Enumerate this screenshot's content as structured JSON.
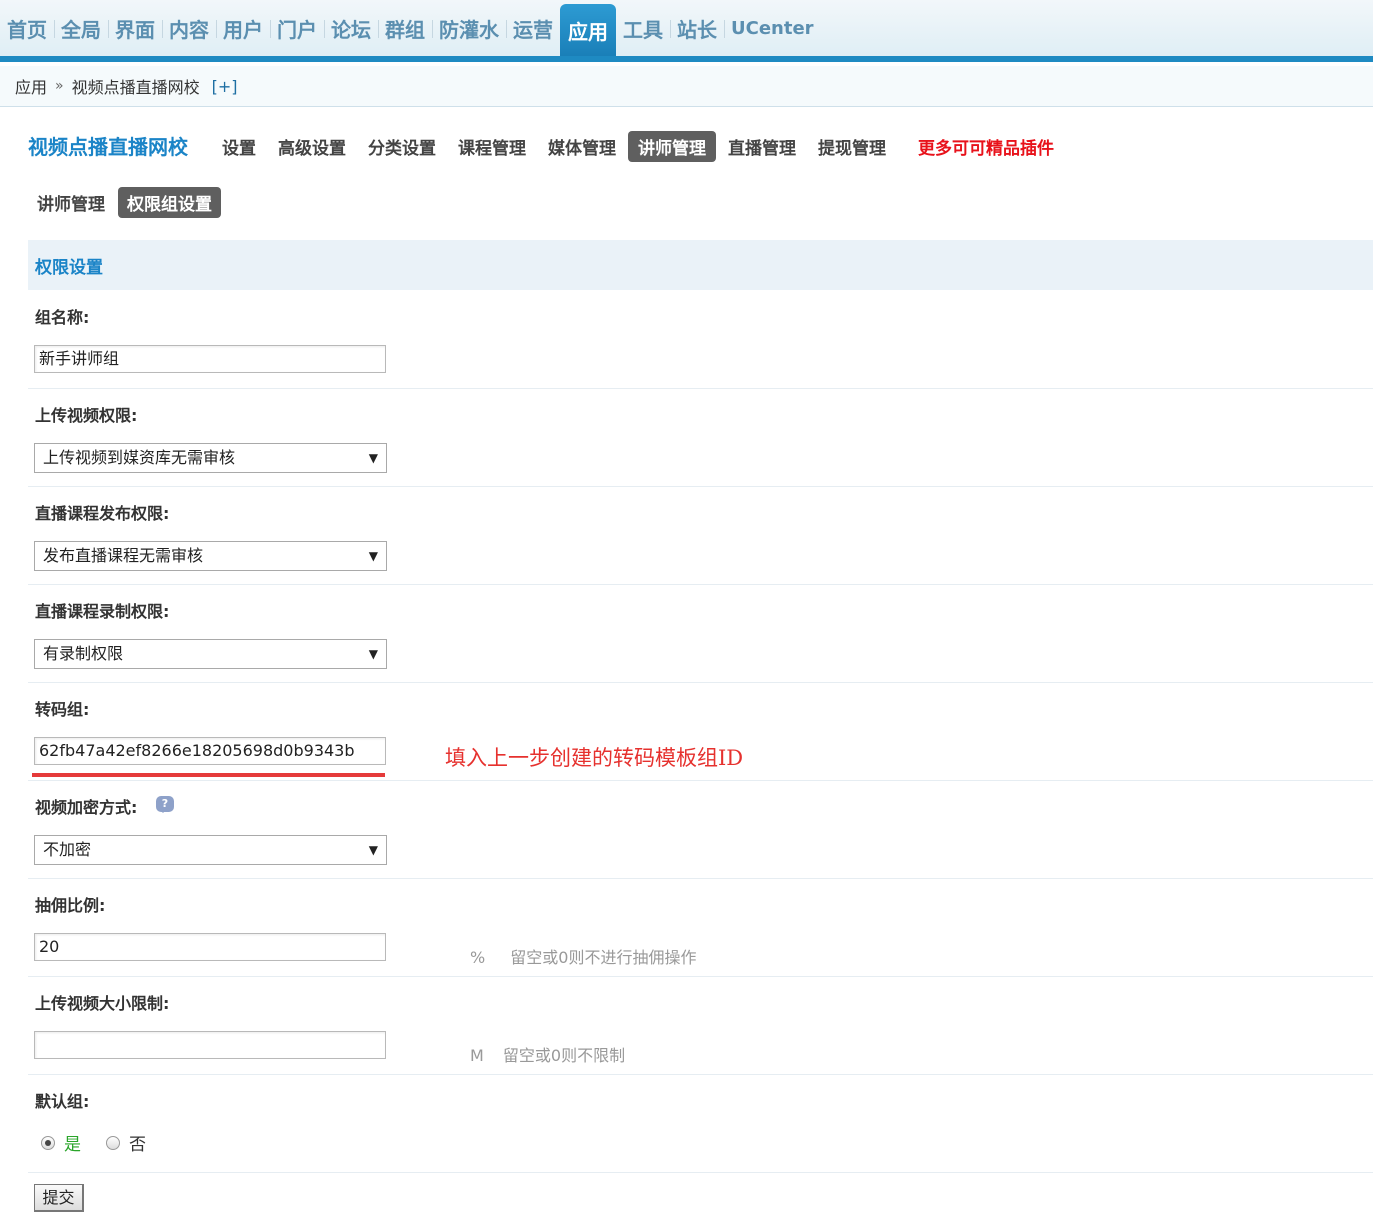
{
  "topnav": {
    "items": [
      "首页",
      "全局",
      "界面",
      "内容",
      "用户",
      "门户",
      "论坛",
      "群组",
      "防灌水",
      "运营",
      "应用",
      "工具",
      "站长",
      "UCenter"
    ],
    "active_index": 10
  },
  "breadcrumb": {
    "app": "应用",
    "separator": "»",
    "plugin": "视频点播直播网校",
    "add": "[+]"
  },
  "plugin": {
    "title": "视频点播直播网校",
    "menu": [
      "设置",
      "高级设置",
      "分类设置",
      "课程管理",
      "媒体管理",
      "讲师管理",
      "直播管理",
      "提现管理"
    ],
    "active_index": 5,
    "more": "更多可可精品插件"
  },
  "submenu": {
    "items": [
      "讲师管理",
      "权限组设置"
    ],
    "active_index": 1
  },
  "section": {
    "title": "权限设置"
  },
  "form": {
    "group_name": {
      "label": "组名称:",
      "value": "新手讲师组"
    },
    "upload_perm": {
      "label": "上传视频权限:",
      "value": "上传视频到媒资库无需审核"
    },
    "live_publish": {
      "label": "直播课程发布权限:",
      "value": "发布直播课程无需审核"
    },
    "live_record": {
      "label": "直播课程录制权限:",
      "value": "有录制权限"
    },
    "transcode": {
      "label": "转码组:",
      "value": "62fb47a42ef8266e18205698d0b9343b",
      "annotation": "填入上一步创建的转码模板组ID"
    },
    "encrypt": {
      "label": "视频加密方式:",
      "value": "不加密",
      "help_icon": "question-bubble-icon"
    },
    "commission": {
      "label": "抽佣比例:",
      "value": "20",
      "unit": "%",
      "tip": "留空或0则不进行抽佣操作"
    },
    "size_limit": {
      "label": "上传视频大小限制:",
      "value": "",
      "unit": "M",
      "tip": "留空或0则不限制"
    },
    "default_group": {
      "label": "默认组:",
      "options": [
        "是",
        "否"
      ],
      "selected": "是"
    },
    "submit": "提交"
  },
  "colors": {
    "nav_active": "#1a7fb8",
    "title_blue": "#1b84c7",
    "annotation_red": "#e6312e",
    "more_red": "#e8121b",
    "yes_green": "#2aa52a"
  }
}
